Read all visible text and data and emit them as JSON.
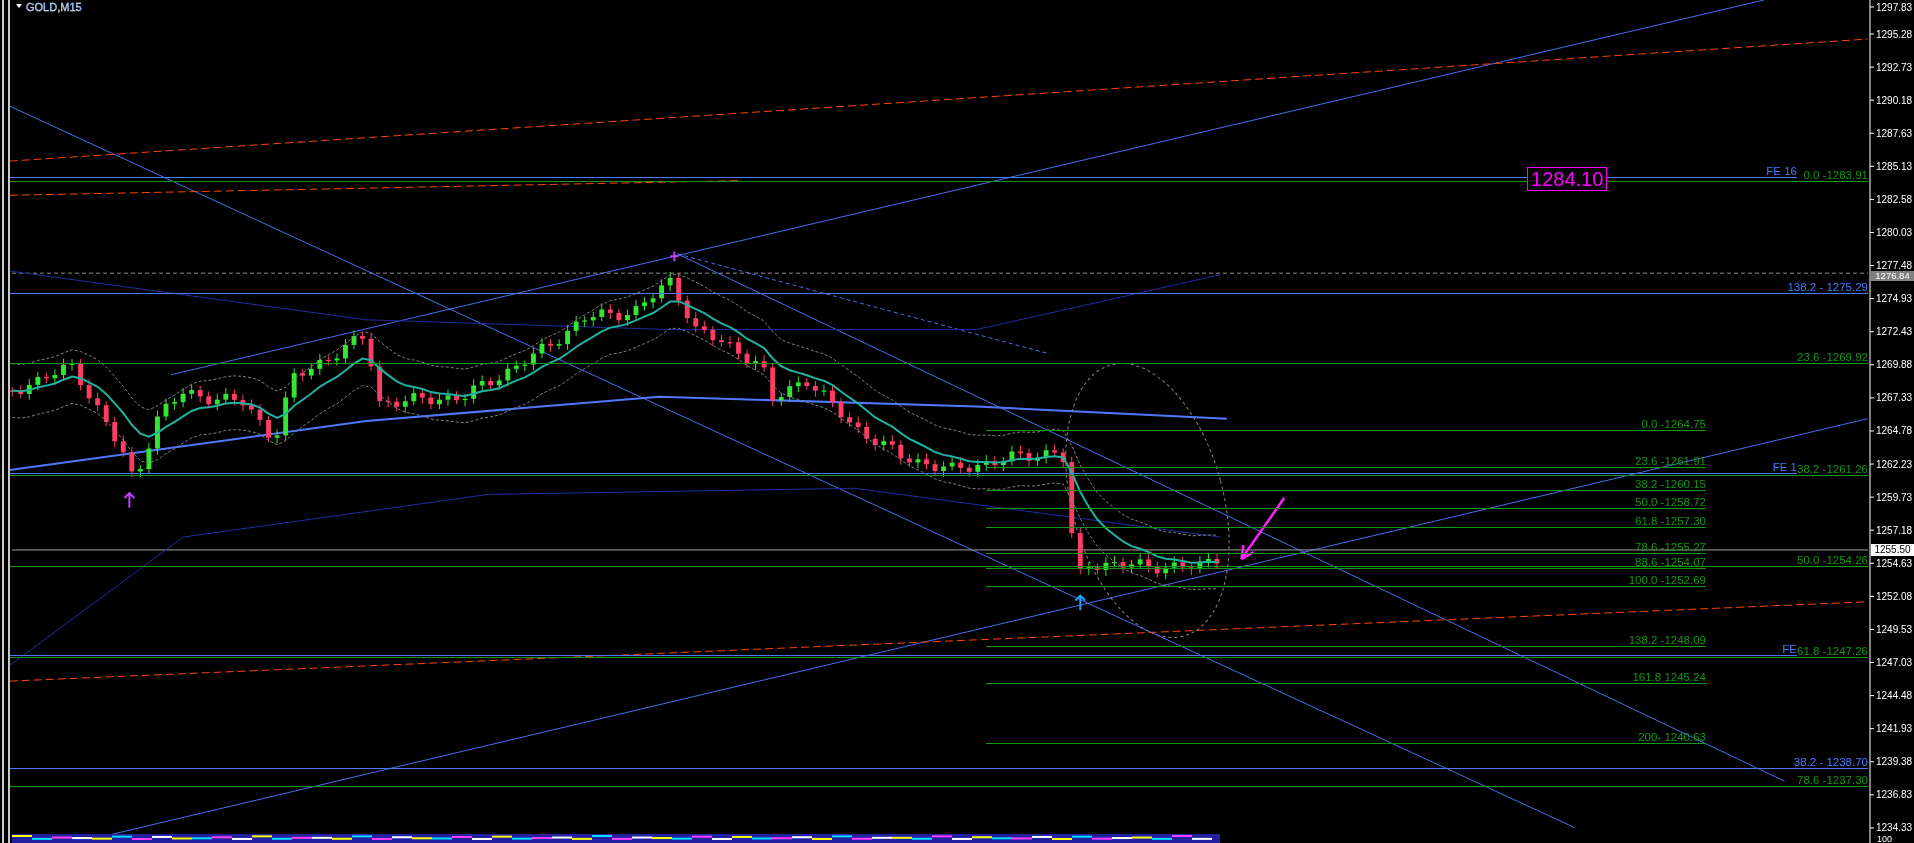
{
  "chart": {
    "symbol_title": "GOLD,M15",
    "price_tag": "1284.10",
    "price_axis": {
      "labels": [
        "1297.83",
        "1295.28",
        "1292.73",
        "1290.18",
        "1287.63",
        "1285.13",
        "1282.58",
        "1280.03",
        "1277.48",
        "1274.93",
        "1272.43",
        "1269.88",
        "1267.33",
        "1264.78",
        "1262.23",
        "1259.73",
        "1257.18",
        "1254.63",
        "1252.08",
        "1249.53",
        "1247.03",
        "1244.48",
        "1241.93",
        "1239.38",
        "1236.83",
        "1234.33"
      ],
      "current_price": "1255.50",
      "marker_price": "1276.84",
      "corner_label": "100"
    },
    "level_labels": [
      {
        "text": "FE 16",
        "kind": "fe",
        "color": "#4a78ff"
      },
      {
        "text": "0.0 -1283.91",
        "kind": "right",
        "color": "#159615"
      },
      {
        "text": "138.2 - 1275.29",
        "kind": "right",
        "color": "#4a78ff"
      },
      {
        "text": "23.6 -1269.92",
        "kind": "right",
        "color": "#159615"
      },
      {
        "text": "0.0 -1264.75",
        "kind": "left",
        "color": "#159615"
      },
      {
        "text": "23.6 -1261.91",
        "kind": "left",
        "color": "#159615"
      },
      {
        "text": "FE 1",
        "kind": "fe",
        "color": "#4a78ff"
      },
      {
        "text": "38.2 -1261.26",
        "kind": "right",
        "color": "#159615"
      },
      {
        "text": "38.2 -1260.15",
        "kind": "left",
        "color": "#159615"
      },
      {
        "text": "50.0 -1258.72",
        "kind": "left",
        "color": "#159615"
      },
      {
        "text": "61.8 -1257.30",
        "kind": "left",
        "color": "#159615"
      },
      {
        "text": "78.6 -1255.27",
        "kind": "left",
        "color": "#159615"
      },
      {
        "text": "88.6 -1254.07",
        "kind": "left",
        "color": "#159615"
      },
      {
        "text": "50.0 -1254.26",
        "kind": "right",
        "color": "#159615"
      },
      {
        "text": "100.0 -1252.69",
        "kind": "left",
        "color": "#159615"
      },
      {
        "text": "138.2  -1248.09",
        "kind": "left",
        "color": "#159615"
      },
      {
        "text": "FE",
        "kind": "fe",
        "color": "#4a78ff"
      },
      {
        "text": "61.8 -1247.26",
        "kind": "right",
        "color": "#159615"
      },
      {
        "text": "161.8 1245.24",
        "kind": "left",
        "color": "#159615"
      },
      {
        "text": "200- 1240.63",
        "kind": "left",
        "color": "#159615"
      },
      {
        "text": "38.2 - 1238.70",
        "kind": "right",
        "color": "#4a78ff"
      },
      {
        "text": "78.6 -1237.30",
        "kind": "right",
        "color": "#159615"
      }
    ]
  }
}
